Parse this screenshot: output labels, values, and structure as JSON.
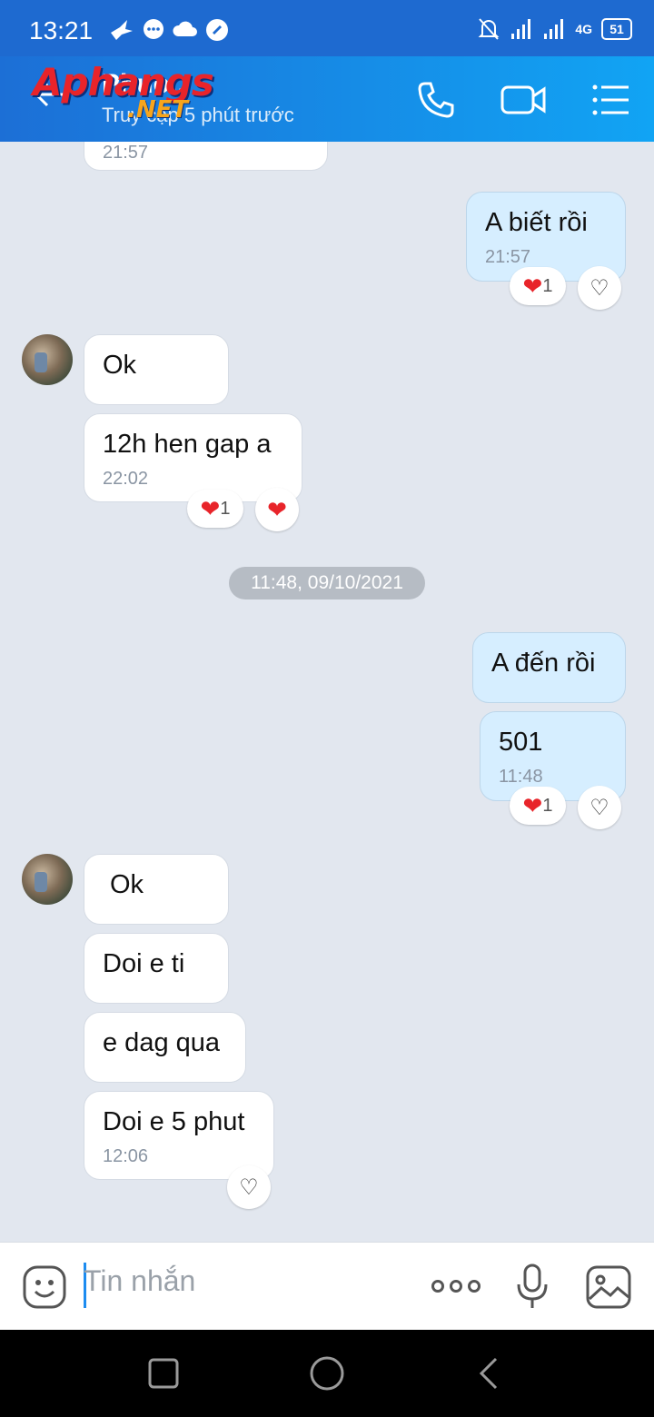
{
  "status_bar": {
    "time": "13:21",
    "network": "4G",
    "battery": "51"
  },
  "header": {
    "name": "Phuo..",
    "status": "Truy cập 5 phút trước",
    "watermark_main": "Aphangs",
    "watermark_sub": ".NET"
  },
  "messages": [
    {
      "time": "21:57"
    },
    {
      "text": "A biết rồi",
      "time": "21:57",
      "reaction_count": "1"
    },
    {
      "text": "Ok"
    },
    {
      "text": "12h hen gap a",
      "time": "22:02",
      "reaction_count": "1"
    },
    {
      "text": "A đến rồi"
    },
    {
      "text": "501",
      "time": "11:48",
      "reaction_count": "1"
    },
    {
      "text": "Ok"
    },
    {
      "text": "Doi e ti"
    },
    {
      "text": "e dag qua"
    },
    {
      "text": "Doi e 5 phut",
      "time": "12:06"
    }
  ],
  "date_separator": "11:48, 09/10/2021",
  "composer": {
    "placeholder": "Tin nhắn"
  },
  "colors": {
    "header_start": "#1c6fd6",
    "header_end": "#11a4f4",
    "my_bubble": "#d6eeff",
    "heart": "#e8242a"
  }
}
